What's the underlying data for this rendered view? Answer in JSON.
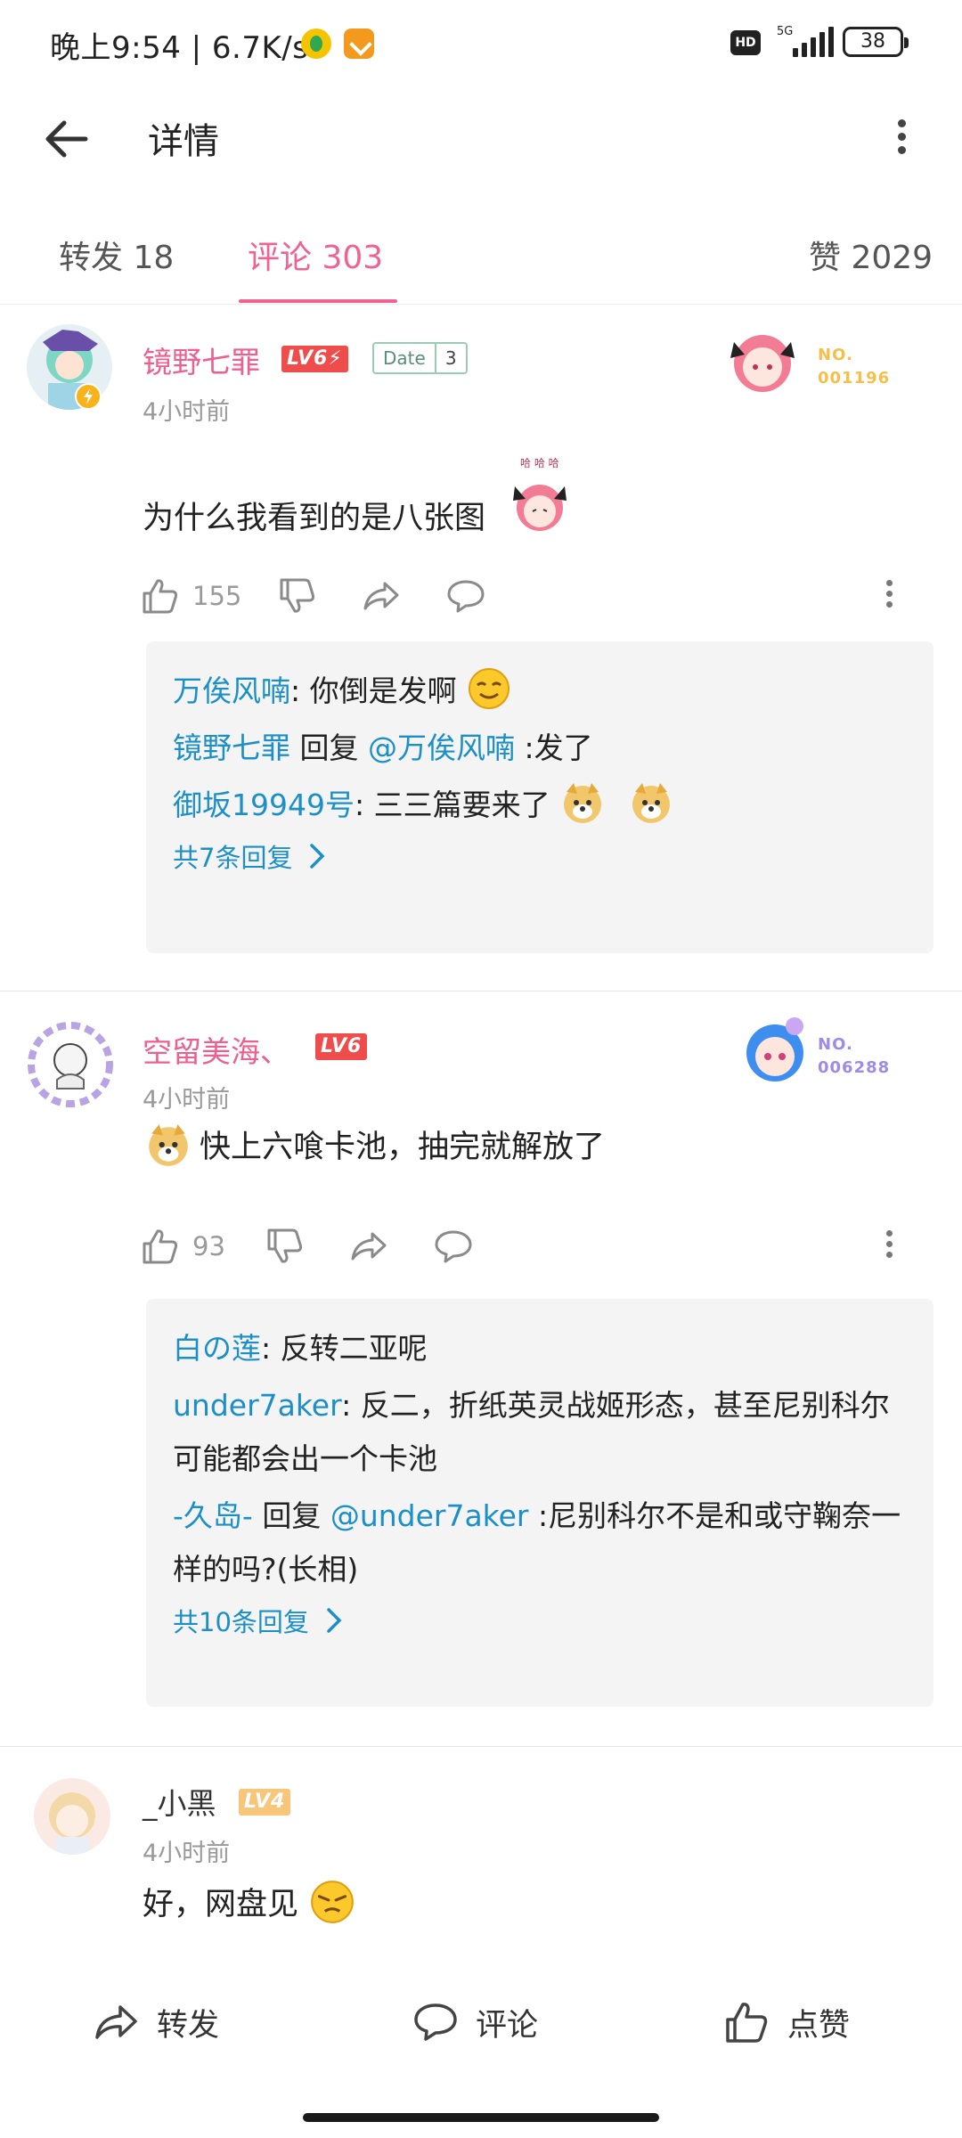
{
  "status_bar": {
    "left_text": "晚上9:54 | 6.7K/s",
    "hd": "HD",
    "net": "5G",
    "battery": "38"
  },
  "header": {
    "title": "详情"
  },
  "tabs": [
    {
      "label": "转发 18"
    },
    {
      "label": "评论 303"
    },
    {
      "label": "赞 2029"
    }
  ],
  "comments": [
    {
      "username": "镜野七罪",
      "level": "LV6⚡",
      "date_badge": {
        "label": "Date",
        "value": "3"
      },
      "time": "4小时前",
      "pendant_no": "NO.",
      "pendant_num": "001196",
      "content": "为什么我看到的是八张图",
      "likes": "155",
      "replies": [
        {
          "name": "万俟风喃",
          "text": ": 你倒是发啊"
        },
        {
          "name": "镜野七罪",
          "mid": " 回复 ",
          "at": "@万俟风喃",
          "text": " :发了"
        },
        {
          "name": "御坂19949号",
          "text": ": 三三篇要来了"
        }
      ],
      "more_replies": "共7条回复"
    },
    {
      "username": "空留美海、",
      "level": "LV6",
      "time": "4小时前",
      "pendant_no": "NO.",
      "pendant_num": "006288",
      "content": "快上六喰卡池，抽完就解放了",
      "likes": "93",
      "replies": [
        {
          "name": "白の莲",
          "text": ": 反转二亚呢"
        },
        {
          "name": "under7aker",
          "text": ": 反二，折纸英灵战姬形态，甚至尼别科尔可能都会出一个卡池"
        },
        {
          "name": "-久岛-",
          "mid": " 回复 ",
          "at": "@under7aker",
          "text": " :尼别科尔不是和或守鞠奈一样的吗?(长相)"
        }
      ],
      "more_replies": "共10条回复"
    },
    {
      "username": "_小黑",
      "level": "LV4",
      "time": "4小时前",
      "content": "好，网盘见"
    }
  ],
  "bottom_bar": {
    "repost": "转发",
    "comment": "评论",
    "like": "点赞"
  },
  "colors": {
    "accent_pink": "#f06292",
    "link_blue": "#1c8fc7",
    "level_red": "#ef4c4c",
    "level_orange": "#f8c67b"
  }
}
